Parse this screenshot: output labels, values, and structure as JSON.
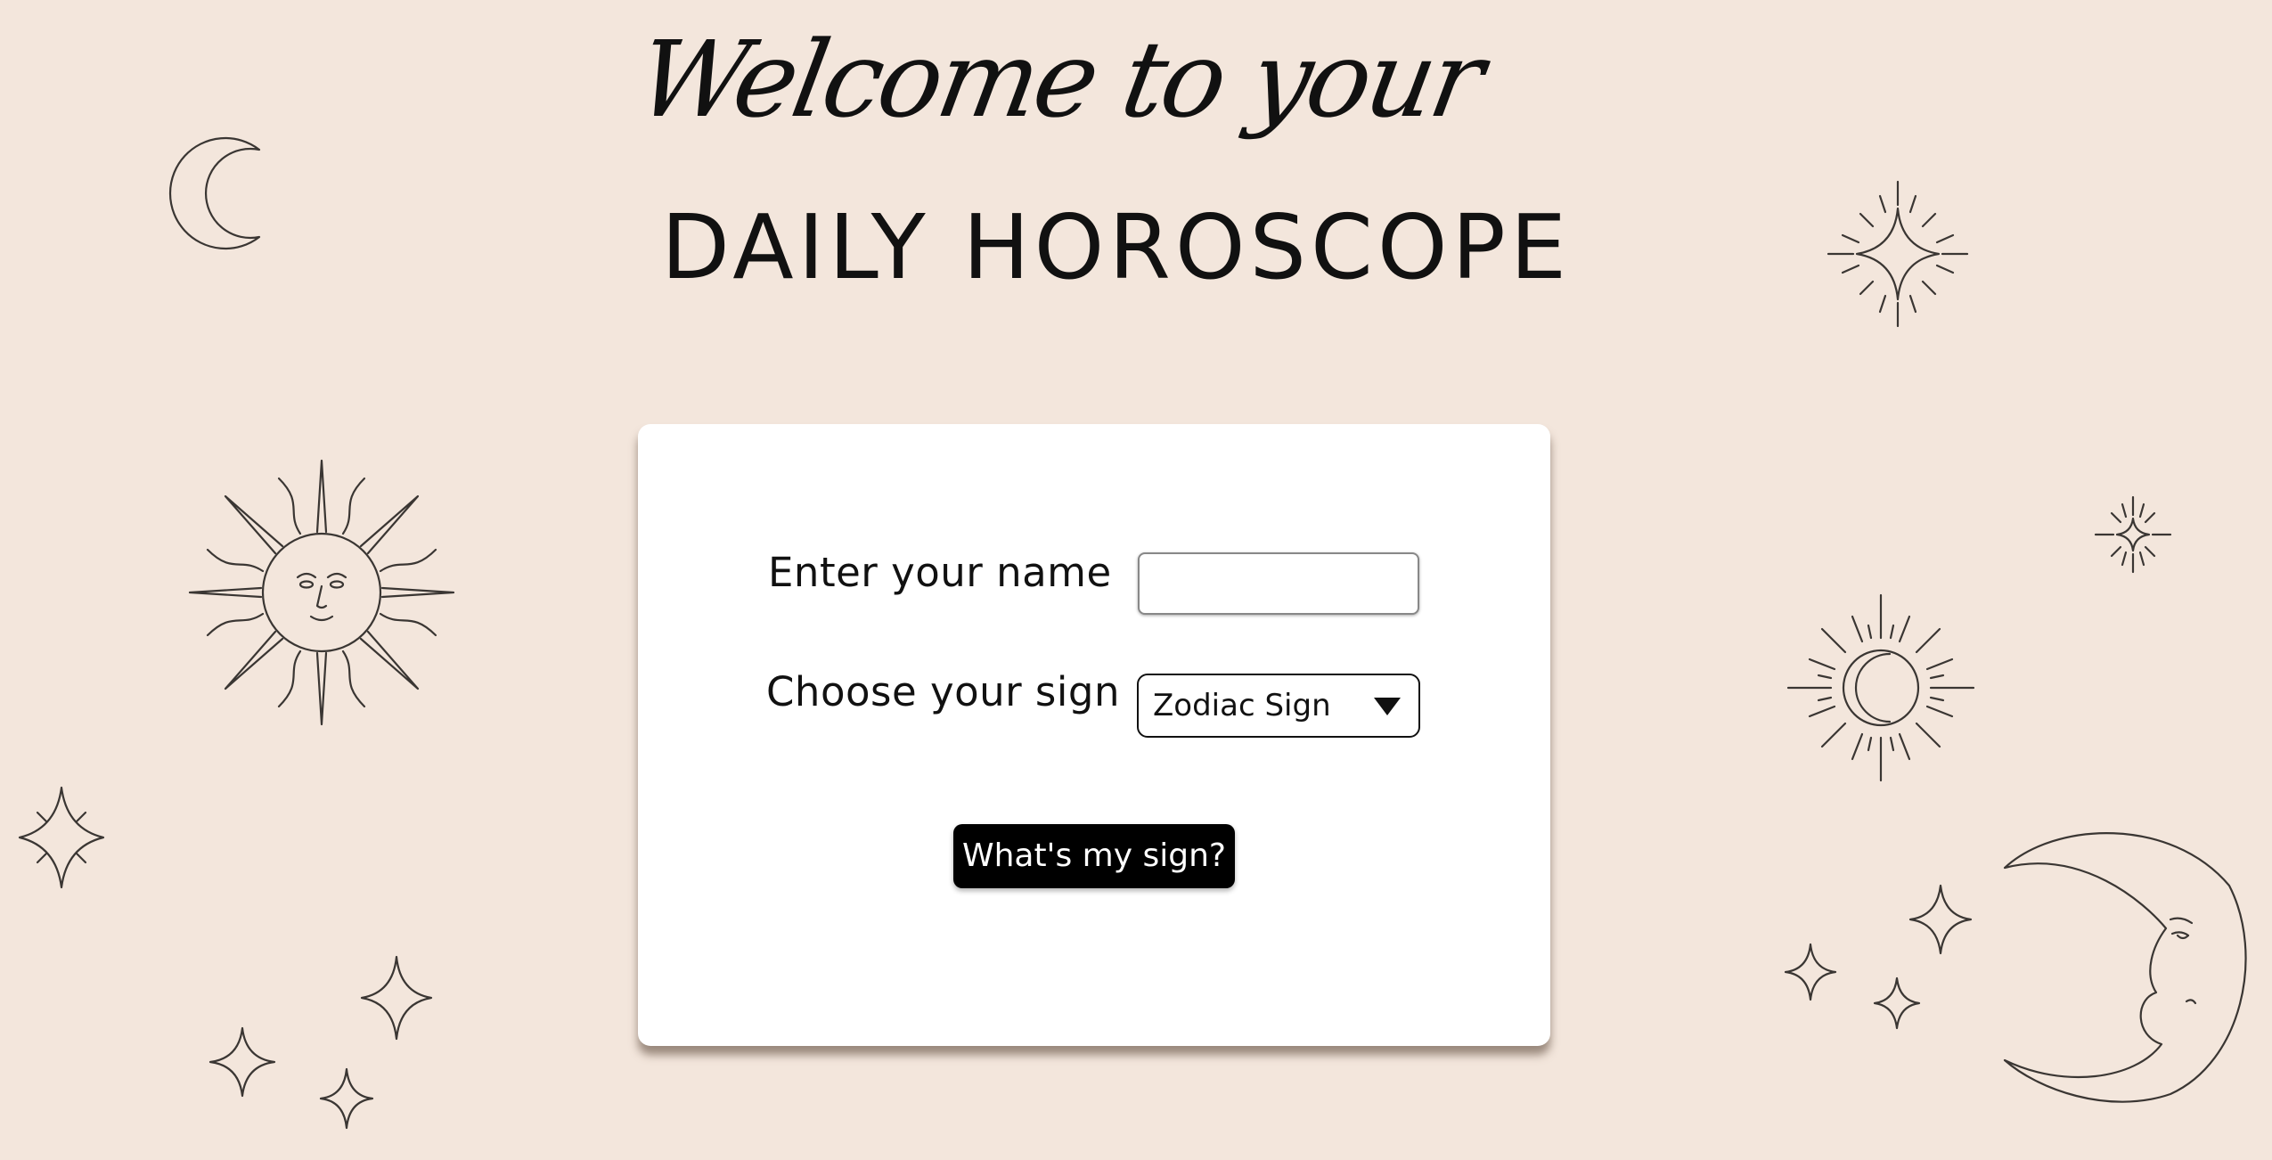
{
  "header": {
    "welcome_text": "Welcome to your",
    "title": "DAILY HOROSCOPE"
  },
  "form": {
    "name_label": "Enter your name",
    "name_value": "",
    "sign_label": "Choose your sign",
    "sign_selected": "Zodiac Sign",
    "submit_label": "What's my sign?"
  },
  "icons": {
    "crescent_moon": "crescent-moon-icon",
    "sun_face": "sun-face-icon",
    "sparkle": "sparkle-star-icon",
    "four_point_star": "four-point-star-icon",
    "moon_face": "moon-face-icon",
    "sunburst_moon": "sunburst-moon-icon"
  },
  "colors": {
    "background": "#f3e6dc",
    "card": "#ffffff",
    "button": "#000000",
    "button_text": "#ffffff",
    "line_art": "#3a3633"
  }
}
